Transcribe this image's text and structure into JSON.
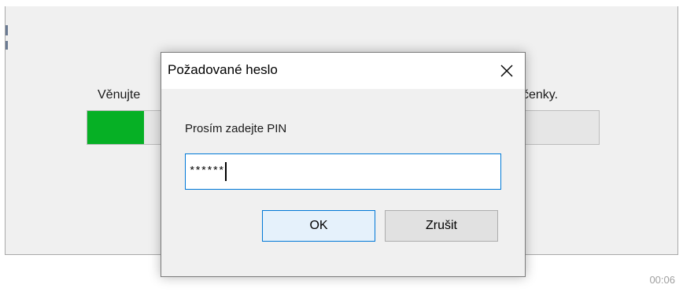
{
  "background_window": {
    "message_left": "Věnujte",
    "message_right": "čenky.",
    "progress_percent": 11,
    "progress_color": "#06b025",
    "timer": "00:06"
  },
  "dialog": {
    "title": "Požadované heslo",
    "close_icon": "close-icon",
    "prompt": "Prosím zadejte PIN",
    "pin_value": "******",
    "ok_label": "OK",
    "cancel_label": "Zrušit",
    "focus_color": "#0078d7"
  }
}
